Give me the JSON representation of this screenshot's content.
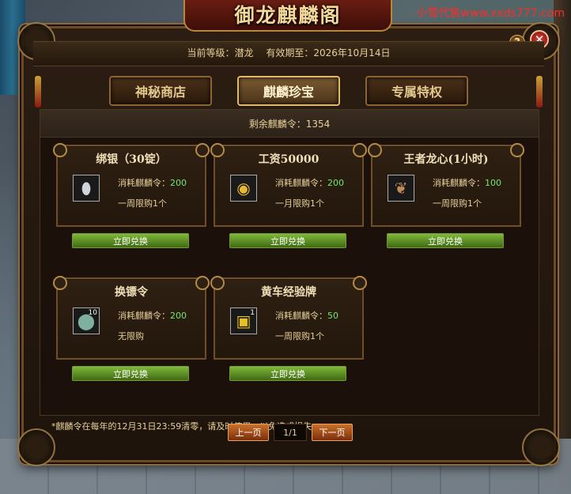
{
  "watermark": "小雪代售www.xxds777.com",
  "window": {
    "title": "御龙麒麟阁",
    "help_label": "?",
    "close_label": "✕"
  },
  "info": {
    "level_label": "当前等级：潜龙",
    "expire_label": "有效期至：2026年10月14日"
  },
  "tabs": [
    {
      "label": "神秘商店",
      "active": false
    },
    {
      "label": "麒麟珍宝",
      "active": true
    },
    {
      "label": "专属特权",
      "active": false
    }
  ],
  "remain": "剩余麒麟令：1354",
  "items": [
    {
      "title": "绑银（30锭）",
      "cost_label": "消耗麒麟令：",
      "cost": "200",
      "limit": "一周限购1个",
      "icon": "silver-ingot-icon",
      "count": "",
      "button": "立即兑换"
    },
    {
      "title": "工资50000",
      "cost_label": "消耗麒麟令：",
      "cost": "200",
      "limit": "一月限购1个",
      "icon": "gold-scroll-icon",
      "count": "",
      "button": "立即兑换"
    },
    {
      "title": "王者龙心(1小时)",
      "cost_label": "消耗麒麟令：",
      "cost": "100",
      "limit": "一周限购1个",
      "icon": "dragon-heart-icon",
      "count": "",
      "button": "立即兑换"
    },
    {
      "title": "换镖令",
      "cost_label": "消耗麒麟令：",
      "cost": "200",
      "limit": "无限购",
      "icon": "escort-token-icon",
      "count": "10",
      "button": "立即兑换"
    },
    {
      "title": "黄车经验牌",
      "cost_label": "消耗麒麟令：",
      "cost": "50",
      "limit": "一周限购1个",
      "icon": "gold-cart-icon",
      "count": "1",
      "button": "立即兑换"
    }
  ],
  "note": "*麒麟令在每年的12月31日23:59清零，请及时使用，以免造成损失。",
  "pager": {
    "prev": "上一页",
    "page": "1/1",
    "next": "下一页"
  }
}
